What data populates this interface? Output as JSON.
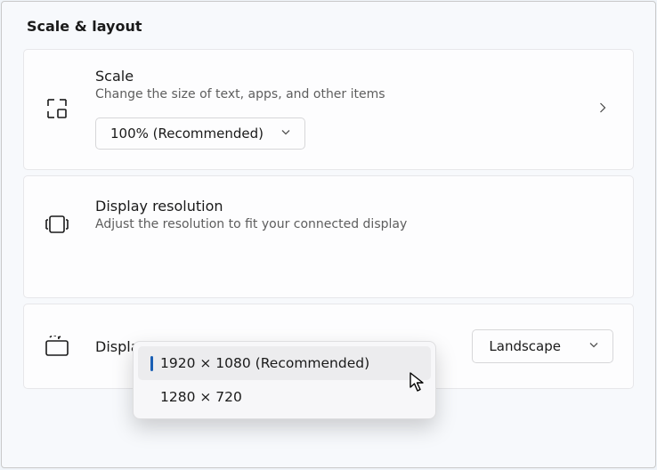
{
  "section_title": "Scale & layout",
  "scale": {
    "title": "Scale",
    "subtitle": "Change the size of text, apps, and other items",
    "value": "100% (Recommended)"
  },
  "resolution": {
    "title": "Display resolution",
    "subtitle": "Adjust the resolution to fit your connected display",
    "options": [
      "1920 × 1080 (Recommended)",
      "1280 × 720"
    ],
    "selected_index": 0
  },
  "orientation": {
    "title": "Display orientation",
    "value": "Landscape"
  }
}
